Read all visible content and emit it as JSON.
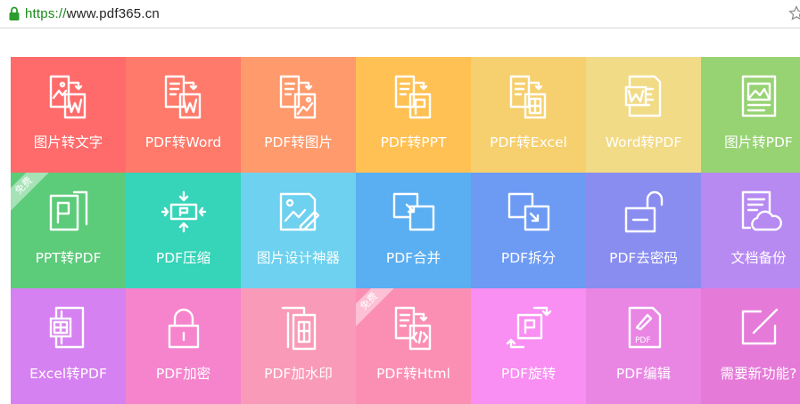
{
  "browser": {
    "url_scheme": "https://",
    "url_rest": "www.pdf365.cn"
  },
  "tiles": [
    {
      "label": "图片转文字",
      "color": "#ff6b6b",
      "icon": "image-to-word-icon"
    },
    {
      "label": "PDF转Word",
      "color": "#ff7a6a",
      "icon": "pdf-to-word-icon"
    },
    {
      "label": "PDF转图片",
      "color": "#ff9a6c",
      "icon": "pdf-to-image-icon"
    },
    {
      "label": "PDF转PPT",
      "color": "#ffc153",
      "icon": "pdf-to-ppt-icon"
    },
    {
      "label": "PDF转Excel",
      "color": "#f6d06e",
      "icon": "pdf-to-excel-icon"
    },
    {
      "label": "Word转PDF",
      "color": "#f2db86",
      "icon": "word-to-pdf-icon"
    },
    {
      "label": "图片转PDF",
      "color": "#97d373",
      "icon": "image-to-pdf-icon"
    },
    {
      "label": "PPT转PDF",
      "color": "#5ccb7a",
      "icon": "ppt-to-pdf-icon",
      "badge": "免费"
    },
    {
      "label": "PDF压缩",
      "color": "#36d4b9",
      "icon": "pdf-compress-icon"
    },
    {
      "label": "图片设计神器",
      "color": "#6dd1ef",
      "icon": "image-design-icon"
    },
    {
      "label": "PDF合并",
      "color": "#5aaef2",
      "icon": "pdf-merge-icon"
    },
    {
      "label": "PDF拆分",
      "color": "#6d9af3",
      "icon": "pdf-split-icon"
    },
    {
      "label": "PDF去密码",
      "color": "#8a8df0",
      "icon": "pdf-unlock-icon"
    },
    {
      "label": "文档备份",
      "color": "#b78af2",
      "icon": "cloud-backup-icon"
    },
    {
      "label": "Excel转PDF",
      "color": "#d681f1",
      "icon": "excel-to-pdf-icon"
    },
    {
      "label": "PDF加密",
      "color": "#f584cd",
      "icon": "pdf-encrypt-icon"
    },
    {
      "label": "PDF加水印",
      "color": "#f99ab8",
      "icon": "pdf-watermark-icon"
    },
    {
      "label": "PDF转Html",
      "color": "#fb8fb3",
      "icon": "pdf-to-html-icon",
      "badge": "免费"
    },
    {
      "label": "PDF旋转",
      "color": "#f98ef3",
      "icon": "pdf-rotate-icon"
    },
    {
      "label": "PDF编辑",
      "color": "#e986e4",
      "icon": "pdf-edit-icon"
    },
    {
      "label": "需要新功能?",
      "color": "#e57ad8",
      "icon": "new-feature-icon"
    }
  ]
}
